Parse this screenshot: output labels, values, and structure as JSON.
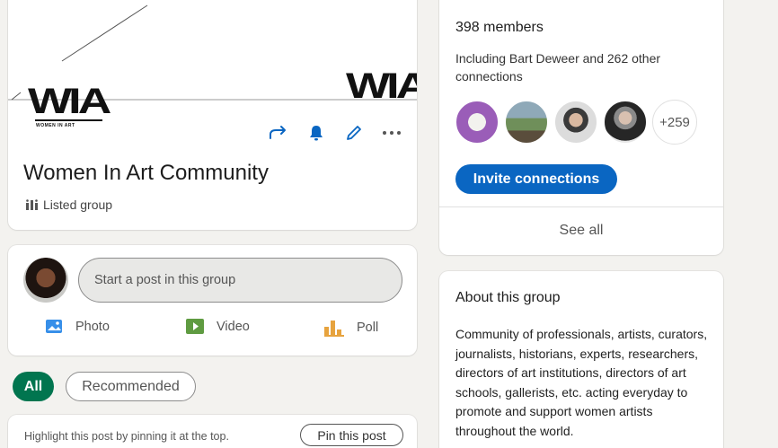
{
  "group": {
    "logo_text": "WIA",
    "logo_subtext": "WOMEN IN ART",
    "name": "Women In Art Community",
    "type": "Listed group",
    "actions": {
      "share_icon": "share-arrow-icon",
      "notify_icon": "bell-icon",
      "edit_icon": "pencil-icon",
      "more_icon": "more-dots-icon"
    }
  },
  "composer": {
    "placeholder": "Start a post in this group",
    "photo_label": "Photo",
    "video_label": "Video",
    "poll_label": "Poll"
  },
  "filters": {
    "all_label": "All",
    "recommended_label": "Recommended"
  },
  "pin": {
    "text": "Highlight this post by pinning it at the top.",
    "button_label": "Pin this post"
  },
  "members": {
    "count_label": "398 members",
    "description": "Including Bart Deweer and 262 other connections",
    "more_count": "+259",
    "invite_label": "Invite connections",
    "see_all_label": "See all"
  },
  "about": {
    "title": "About this group",
    "body": "Community of professionals, artists, curators, journalists, historians, experts, researchers, directors of art institutions, directors of art schools, gallerists, etc. acting everyday to promote and support women artists throughout the world."
  },
  "colors": {
    "primary_blue": "#0a66c2",
    "green_active": "#01754f",
    "background": "#f3f2ef"
  }
}
